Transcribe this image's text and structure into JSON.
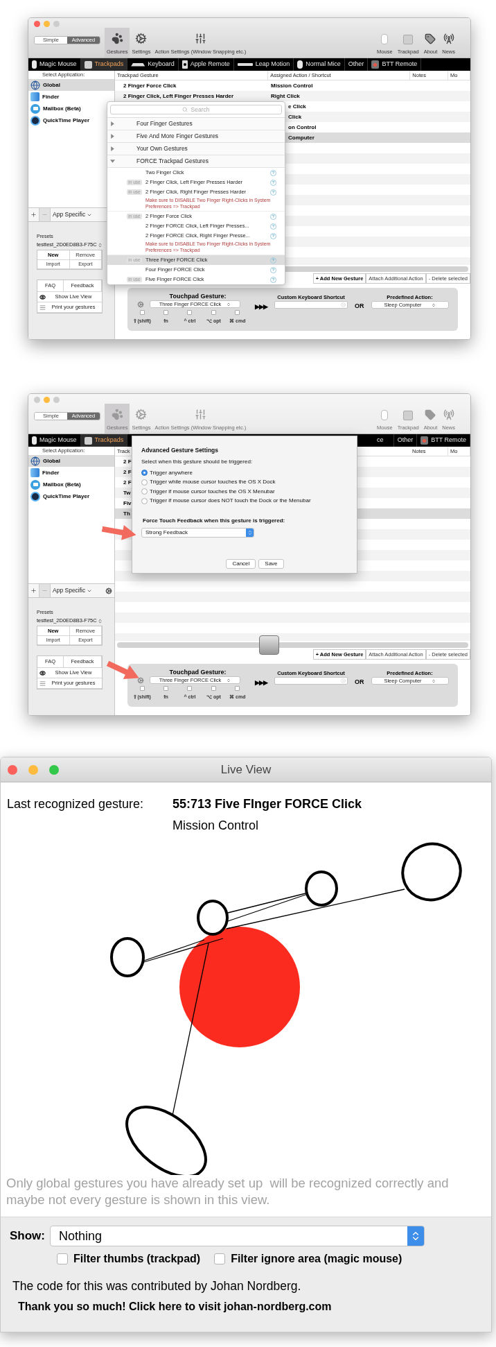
{
  "screenshots": [
    {
      "kind": "btt",
      "active": true,
      "traffic_lights": [
        {
          "color": "#fc605b"
        },
        {
          "color": "#fdbc40"
        },
        {
          "color": "#cdcdcd"
        }
      ],
      "modes": [
        {
          "label": "Simple",
          "selected": false
        },
        {
          "label": "Advanced",
          "selected": true
        }
      ],
      "toolbar_left": [
        {
          "kind": "paw",
          "label": "Gestures",
          "selected": true
        },
        {
          "kind": "gears",
          "label": "Settings",
          "selected": false
        },
        {
          "kind": "sliders",
          "label": "Action Settings (Window Snapping etc.)",
          "selected": false
        }
      ],
      "toolbar_right": [
        {
          "kind": "mouse",
          "label": "Mouse"
        },
        {
          "kind": "trackpad",
          "label": "Trackpad"
        },
        {
          "kind": "tag",
          "label": "About"
        },
        {
          "kind": "antenna",
          "label": "News"
        }
      ],
      "device_tabs": [
        {
          "kind": "magic-mouse",
          "label": "Magic Mouse",
          "selected": false
        },
        {
          "kind": "trackpad",
          "label": "Trackpads",
          "selected": true
        },
        {
          "kind": "keyboard",
          "label": "Keyboard",
          "selected": false
        },
        {
          "kind": "remote",
          "label": "Apple Remote",
          "selected": false
        },
        {
          "kind": "leap",
          "label": "Leap Motion",
          "selected": false
        },
        {
          "kind": "mouse",
          "label": "Normal Mice",
          "selected": false
        },
        {
          "kind": "none",
          "label": "Other",
          "selected": false
        },
        {
          "kind": "btt",
          "label": "BTT Remote",
          "selected": false
        }
      ],
      "sidebar": {
        "heading": "Select Application:",
        "apps": [
          {
            "kind": "globe",
            "label": "Global",
            "selected": true
          },
          {
            "kind": "finder",
            "label": "Finder",
            "selected": false
          },
          {
            "kind": "mail",
            "label": "Mailbox (Beta)",
            "selected": false
          },
          {
            "kind": "quicktime",
            "label": "QuickTime Player",
            "selected": false
          }
        ],
        "filter": "App Specific",
        "filter_gear": false,
        "presets_label": "Presets",
        "preset": "testtest_2D0ED8B3-F75C",
        "preset_buttons": [
          {
            "label": "New",
            "kind": "primary"
          },
          {
            "label": "Remove",
            "kind": "normal"
          },
          {
            "label": "Import",
            "kind": "small"
          },
          {
            "label": "Export",
            "kind": "small"
          }
        ],
        "support_buttons": [
          {
            "label": "FAQ"
          },
          {
            "label": "Feedback"
          }
        ],
        "links": [
          {
            "kind": "eye",
            "label": "Show Live View"
          },
          {
            "kind": "list",
            "label": "Print your gestures"
          }
        ]
      },
      "table": {
        "columns": [
          {
            "kind": "gesture",
            "label": "Trackpad Gesture"
          },
          {
            "kind": "action",
            "label": "Assigned Action / Shortcut"
          },
          {
            "kind": "notes",
            "label": "Notes"
          },
          {
            "kind": "more",
            "label": "Mo"
          }
        ],
        "rows": [
          {
            "kind": "full",
            "gesture": "2 Finger Force Click",
            "action": "Mission Control",
            "selected": false
          },
          {
            "kind": "full",
            "gesture": "2 Finger Click, Left Finger Presses Harder",
            "action": "Right Click",
            "selected": false
          },
          {
            "kind": "covered",
            "action": "e Click",
            "selected": false
          },
          {
            "kind": "covered",
            "action": "Click",
            "selected": false
          },
          {
            "kind": "covered",
            "action": "on Control",
            "selected": false
          },
          {
            "kind": "covered",
            "action": "Computer",
            "selected": true
          }
        ]
      },
      "magnified_scroll_knob": false,
      "action_buttons": [
        {
          "label": "+ Add New Gesture",
          "kind": "primary"
        },
        {
          "label": "Attach Additional Action",
          "kind": "normal"
        },
        {
          "label": "- Delete selected",
          "kind": "normal"
        }
      ],
      "config": {
        "title": "Touchpad Gesture:",
        "gesture": "Three Finger FORCE Click",
        "arrows": "▶▶▶",
        "modifiers": [
          {
            "label": "⇧(shift)",
            "checked": false
          },
          {
            "label": "fn",
            "checked": false
          },
          {
            "label": "^ ctrl",
            "checked": false
          },
          {
            "label": "⌥ opt",
            "checked": false
          },
          {
            "label": "⌘ cmd",
            "checked": false
          }
        ],
        "shortcut_label": "Custom Keyboard Shortcut",
        "or": "OR",
        "predefined_label": "Predefined Action:",
        "predefined": "Sleep Computer",
        "pointer_arrow": false
      },
      "overlay": {
        "kind": "gesture_menu",
        "search_placeholder": "Search",
        "groups": [
          {
            "label": "Four Finger Gestures",
            "expanded": false
          },
          {
            "label": "Five And More Finger Gestures",
            "expanded": false
          },
          {
            "label": "Your Own Gestures",
            "expanded": false
          },
          {
            "label": "FORCE Trackpad Gestures",
            "expanded": true,
            "items": [
              {
                "label": "Two Finger Click",
                "help": "?",
                "selected": false
              },
              {
                "badge": "in use",
                "label": "2 Finger Click, Left Finger Presses Harder",
                "help": "?",
                "selected": false
              },
              {
                "badge": "in use",
                "label": "2 Finger Click, Right Finger Presses Harder",
                "help": "?",
                "selected": false,
                "warning": "Make sure to DISABLE Two Finger Right-Clicks in System Preferences => Trackpad"
              },
              {
                "badge": "in use",
                "label": "2 Finger Force Click",
                "help": "?",
                "selected": false
              },
              {
                "label": "2 Finger FORCE Click, Left Finger Presses...",
                "help": "?",
                "selected": false
              },
              {
                "label": "2 Finger FORCE Click, Right Finger Presse...",
                "help": "?",
                "selected": false,
                "warning": "Make sure to DISABLE Two Finger Right-Clicks in System Preferences => Trackpad"
              },
              {
                "badge": "in use",
                "label": "Three Finger FORCE Click",
                "help": "?",
                "selected": true
              },
              {
                "label": "Four Finger FORCE Click",
                "help": "?",
                "selected": false
              },
              {
                "badge": "in use",
                "label": "Five FInger FORCE Click",
                "help": "?",
                "selected": false
              }
            ]
          }
        ]
      }
    },
    {
      "kind": "btt",
      "active": false,
      "traffic_lights": [
        {
          "color": "#cdcdcd"
        },
        {
          "color": "#fdbc40"
        },
        {
          "color": "#cdcdcd"
        }
      ],
      "modes": [
        {
          "label": "Simple",
          "selected": false
        },
        {
          "label": "Advanced",
          "selected": true
        }
      ],
      "toolbar_left": [
        {
          "kind": "paw",
          "label": "Gestures",
          "selected": true
        },
        {
          "kind": "gears",
          "label": "Settings",
          "selected": false
        },
        {
          "kind": "sliders",
          "label": "Action Settings (Window Snapping etc.)",
          "selected": false
        }
      ],
      "toolbar_right": [
        {
          "kind": "mouse",
          "label": "Mouse"
        },
        {
          "kind": "trackpad",
          "label": "Trackpad"
        },
        {
          "kind": "tag",
          "label": "About"
        },
        {
          "kind": "antenna",
          "label": "News"
        }
      ],
      "device_tabs": [
        {
          "kind": "magic-mouse",
          "label": "Magic Mouse",
          "selected": false
        },
        {
          "kind": "trackpad",
          "label": "Trackpads",
          "selected": true
        },
        {
          "kind": "partial",
          "label": "ce",
          "selected": false
        },
        {
          "kind": "none",
          "label": "Other",
          "selected": false
        },
        {
          "kind": "btt",
          "label": "BTT Remote",
          "selected": false
        }
      ],
      "sidebar": {
        "heading": "Select Application:",
        "apps": [
          {
            "kind": "globe",
            "label": "Global",
            "selected": true
          },
          {
            "kind": "finder",
            "label": "Finder",
            "selected": false
          },
          {
            "kind": "mail",
            "label": "Mailbox (Beta)",
            "selected": false
          },
          {
            "kind": "quicktime",
            "label": "QuickTime Player",
            "selected": false
          }
        ],
        "filter": "App Specific",
        "filter_gear": true,
        "presets_label": "Presets",
        "preset": "testtest_2D0ED8B3-F75C",
        "preset_buttons": [
          {
            "label": "New",
            "kind": "primary"
          },
          {
            "label": "Remove",
            "kind": "normal"
          },
          {
            "label": "Import",
            "kind": "small"
          },
          {
            "label": "Export",
            "kind": "small"
          }
        ],
        "support_buttons": [
          {
            "label": "FAQ"
          },
          {
            "label": "Feedback"
          }
        ],
        "links": [
          {
            "kind": "eye",
            "label": "Show Live View"
          },
          {
            "kind": "list",
            "label": "Print your gestures"
          }
        ]
      },
      "table": {
        "columns": [
          {
            "kind": "gesture",
            "label": "Track"
          },
          {
            "kind": "notes",
            "label": "Notes"
          },
          {
            "kind": "more",
            "label": "Mo"
          }
        ],
        "rows": [
          {
            "kind": "cut",
            "gesture": "2 F",
            "selected": false
          },
          {
            "kind": "cut",
            "gesture": "2 F",
            "selected": false
          },
          {
            "kind": "cut",
            "gesture": "2 F",
            "selected": false
          },
          {
            "kind": "cut",
            "gesture": "Tw",
            "selected": false
          },
          {
            "kind": "cut",
            "gesture": "Fiv",
            "selected": false
          },
          {
            "kind": "cut",
            "gesture": "Th",
            "selected": true
          }
        ]
      },
      "magnified_scroll_knob": true,
      "action_buttons": [
        {
          "label": "+ Add New Gesture",
          "kind": "primary"
        },
        {
          "label": "Attach Additional Action",
          "kind": "normal"
        },
        {
          "label": "- Delete selected",
          "kind": "normal"
        }
      ],
      "config": {
        "title": "Touchpad Gesture:",
        "gesture": "Three Finger FORCE Click",
        "arrows": "▶▶▶",
        "modifiers": [
          {
            "label": "⇧(shift)",
            "checked": false
          },
          {
            "label": "fn",
            "checked": false
          },
          {
            "label": "^ ctrl",
            "checked": false
          },
          {
            "label": "⌥ opt",
            "checked": false
          },
          {
            "label": "⌘ cmd",
            "checked": false
          }
        ],
        "shortcut_label": "Custom Keyboard Shortcut",
        "or": "OR",
        "predefined_label": "Predefined Action:",
        "predefined": "Sleep Computer",
        "pointer_arrow": true
      },
      "overlay": {
        "kind": "advanced_dialog",
        "title": "Advanced Gesture Settings",
        "prompt": "Select when this gesture should be triggered:",
        "options": [
          {
            "label": "Trigger anywhere",
            "selected": true
          },
          {
            "label": "Trigger while mouse cursor touches the OS X Dock",
            "selected": false
          },
          {
            "label": "Trigger if mouse cursor touches the OS X Menubar",
            "selected": false
          },
          {
            "label": "Trigger if mouse cursor does NOT touch the Dock or the Menubar",
            "selected": false
          }
        ],
        "feedback_label": "Force Touch Feedback when this gesture is triggered:",
        "feedback": "Strong Feedback",
        "pointer_arrow": true,
        "buttons": [
          {
            "label": "Cancel"
          },
          {
            "label": "Save"
          }
        ]
      }
    },
    {
      "kind": "live_view",
      "title": "Live View",
      "traffic_lights": [
        {
          "color": "#fc605b"
        },
        {
          "color": "#fdbc40"
        },
        {
          "color": "#34c84a"
        }
      ],
      "last_label": "Last recognized gesture:",
      "last_gesture": "55:713 Five FInger FORCE Click",
      "last_action": "Mission Control",
      "note": "Only global gestures you have already set up  will be recognized correctly and maybe not every gesture is shown in this view.",
      "show_label": "Show:",
      "show_value": "Nothing",
      "filters": [
        {
          "label": "Filter thumbs (trackpad)",
          "checked": false
        },
        {
          "label": "Filter ignore area (magic mouse)",
          "checked": false
        }
      ],
      "credit": "The code for this was contributed by Johan Nordberg.",
      "link": "Thank you so much! Click here to visit johan-nordberg.com"
    }
  ]
}
